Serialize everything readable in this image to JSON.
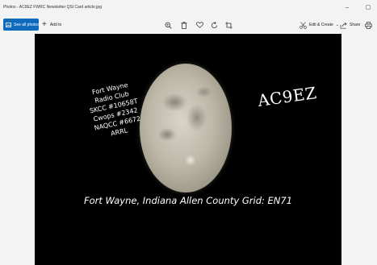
{
  "window": {
    "title": "Photos - AC9EZ FWRC Newsletter QSl Card article.jpg",
    "minimize_glyph": "–",
    "maximize_glyph": "▢"
  },
  "toolbar": {
    "see_all_label": "See all photos",
    "add_to_label": "Add to",
    "edit_create_label": "Edit & Create",
    "share_label": "Share",
    "icons": [
      "zoom-icon",
      "delete-icon",
      "favorite-icon",
      "rotate-icon",
      "crop-icon",
      "print-icon"
    ],
    "accent_color": "#0f6cbd"
  },
  "photo": {
    "club_lines": [
      "Fort Wayne",
      "Radio Club",
      "SKCC #10658T",
      "Cwops #2342",
      "NAQCC #6672",
      "ARRL"
    ],
    "callsign": "AC9EZ",
    "location": "Fort Wayne, Indiana Allen County Grid: EN71"
  }
}
